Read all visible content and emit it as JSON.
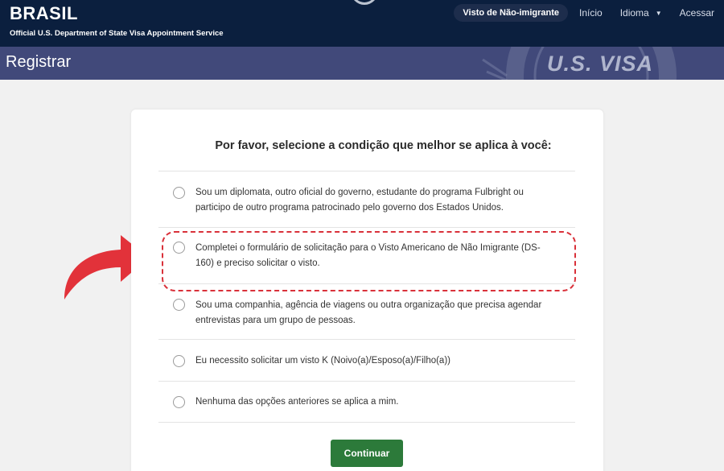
{
  "header": {
    "brand": "BRASIL",
    "subtitle": "Official U.S. Department of State Visa Appointment Service",
    "nav": {
      "visa_type": "Visto de Não-imigrante",
      "home": "Início",
      "language": "Idioma",
      "login": "Acessar"
    }
  },
  "subheader": {
    "title": "Registrar",
    "seal_text": "U.S. VISA"
  },
  "form": {
    "question": "Por favor, selecione a condição que melhor se aplica à você:",
    "options": [
      {
        "line1": "Sou um diplomata, outro oficial do governo, estudante do programa Fulbright ou",
        "line2": "participo de outro programa patrocinado pelo governo dos Estados Unidos."
      },
      {
        "line1": "Completei o formulário de solicitação para o Visto Americano de Não Imigrante (DS-",
        "line2": "160) e preciso solicitar o visto."
      },
      {
        "line1": "Sou uma companhia, agência de viagens ou outra organização que precisa agendar",
        "line2": "entrevistas para um grupo de pessoas."
      },
      {
        "line1": "Eu necessito solicitar um visto K (Noivo(a)/Esposo(a)/Filho(a))"
      },
      {
        "line1": "Nenhuma das opções anteriores se aplica a mim."
      }
    ],
    "continue_label": "Continuar"
  },
  "colors": {
    "header_bg": "#0b1f3e",
    "subheader_bg": "#41497a",
    "button_green": "#2c7a3a",
    "annotation_red": "#d9313a"
  }
}
